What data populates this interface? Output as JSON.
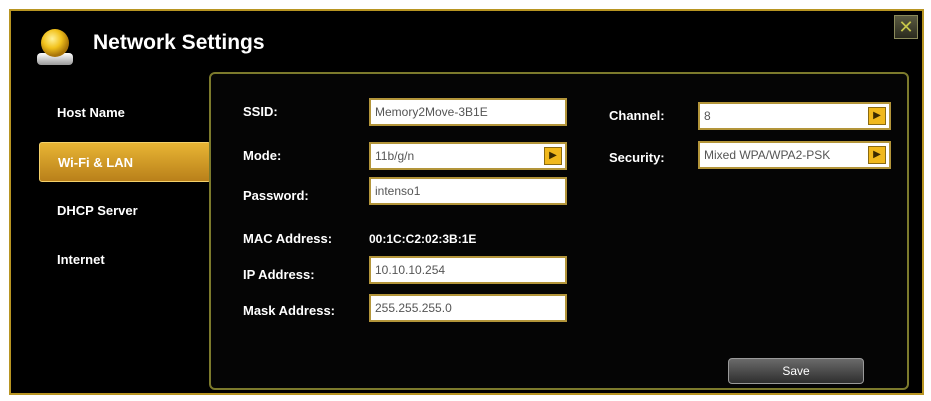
{
  "window": {
    "title": "Network Settings",
    "close_glyph": "✕"
  },
  "sidebar": {
    "items": [
      {
        "label": "Host Name",
        "active": false
      },
      {
        "label": "Wi-Fi & LAN",
        "active": true
      },
      {
        "label": "DHCP Server",
        "active": false
      },
      {
        "label": "Internet",
        "active": false
      }
    ]
  },
  "form": {
    "ssid": {
      "label": "SSID:",
      "value": "Memory2Move-3B1E"
    },
    "mode": {
      "label": "Mode:",
      "value": "11b/g/n"
    },
    "password": {
      "label": "Password:",
      "value": "intenso1"
    },
    "mac": {
      "label": "MAC Address:",
      "value": "00:1C:C2:02:3B:1E"
    },
    "ip": {
      "label": "IP Address:",
      "value": "10.10.10.254"
    },
    "mask": {
      "label": "Mask Address:",
      "value": "255.255.255.0"
    },
    "channel": {
      "label": "Channel:",
      "value": "8"
    },
    "security": {
      "label": "Security:",
      "value": "Mixed WPA/WPA2-PSK"
    },
    "save_label": "Save"
  },
  "icons": {
    "app": "user-folder-icon",
    "dropdown": "arrow-right-icon",
    "close": "close-icon"
  },
  "colors": {
    "accent": "#e8b534",
    "panel_border": "#7c7a2c",
    "background": "#000000"
  }
}
